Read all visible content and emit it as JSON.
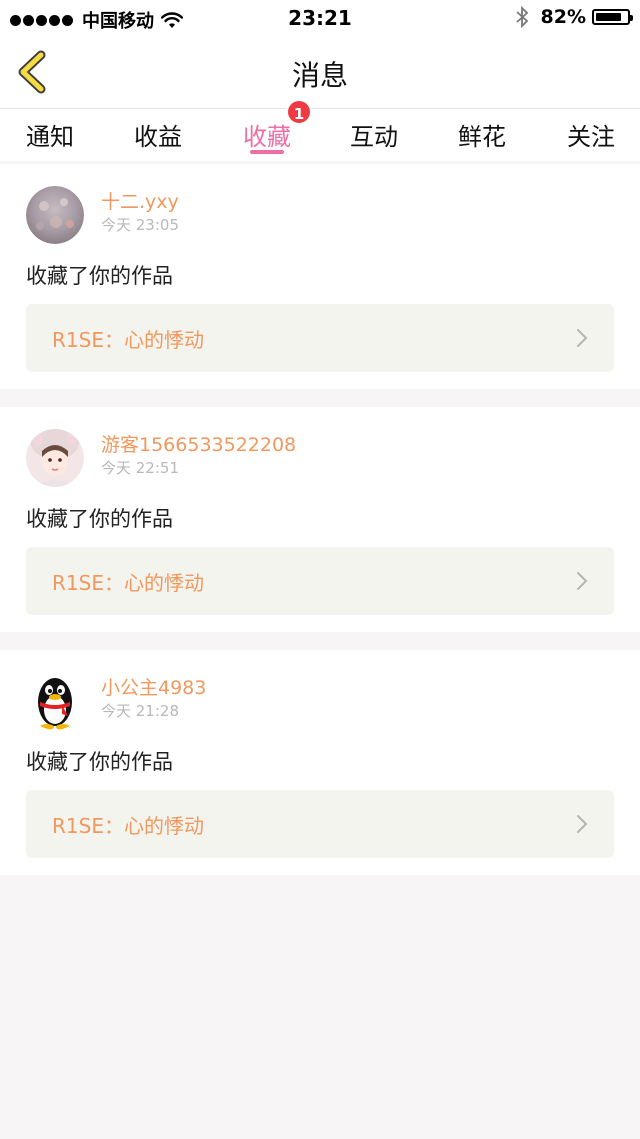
{
  "status_bar": {
    "carrier": "中国移动",
    "time": "23:21",
    "battery_percent": "82%",
    "battery_level": 0.82,
    "icons": [
      "signal-dots-icon",
      "wifi-icon",
      "bluetooth-icon",
      "battery-icon"
    ]
  },
  "header": {
    "title": "消息",
    "back_icon": "chevron-left-icon"
  },
  "tabs": [
    {
      "label": "通知"
    },
    {
      "label": "收益"
    },
    {
      "label": "收藏",
      "active": true,
      "badge": "1"
    },
    {
      "label": "互动"
    },
    {
      "label": "鲜花"
    },
    {
      "label": "关注"
    }
  ],
  "messages": [
    {
      "username": "十二.yxy",
      "time": "今天 23:05",
      "action": "收藏了你的作品",
      "work_title": "R1SE：心的悸动",
      "avatar_icon": "photo-avatar-icon"
    },
    {
      "username": "游客1566533522208",
      "time": "今天 22:51",
      "action": "收藏了你的作品",
      "work_title": "R1SE：心的悸动",
      "avatar_icon": "photo-avatar-icon"
    },
    {
      "username": "小公主4983",
      "time": "今天 21:28",
      "action": "收藏了你的作品",
      "work_title": "R1SE：心的悸动",
      "avatar_icon": "penguin-avatar-icon"
    }
  ],
  "colors": {
    "accent_pink": "#ec6fa7",
    "username_orange": "#f0985e",
    "badge_red": "#ee3a44",
    "back_arrow_yellow": "#f5dc42",
    "work_box_bg": "#f4f4ef"
  }
}
